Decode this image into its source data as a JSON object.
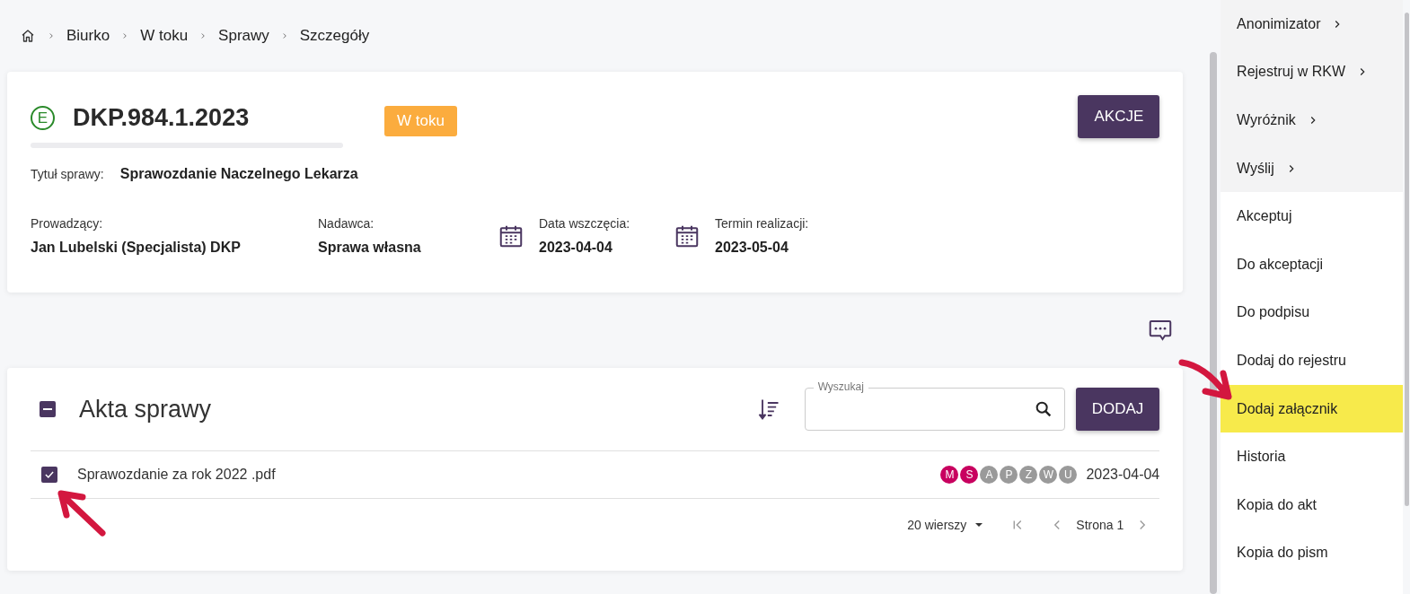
{
  "breadcrumb": [
    "Biurko",
    "W toku",
    "Sprawy",
    "Szczegóły"
  ],
  "case": {
    "badge": "E",
    "number": "DKP.984.1.2023",
    "status": "W toku",
    "actions_button": "AKCJE",
    "title_label": "Tytuł sprawy:",
    "title": "Sprawozdanie Naczelnego Lekarza",
    "fields": [
      {
        "kind": "text",
        "label": "Prowadzący:",
        "value": "Jan Lubelski (Specjalista) DKP"
      },
      {
        "kind": "text",
        "label": "Nadawca:",
        "value": "Sprawa własna"
      },
      {
        "kind": "date",
        "label": "Data wszczęcia:",
        "value": "2023-04-04"
      },
      {
        "kind": "date",
        "label": "Termin realizacji:",
        "value": "2023-05-04"
      }
    ]
  },
  "files": {
    "title": "Akta sprawy",
    "select_all_partial": true,
    "search": {
      "label": "Wyszukaj"
    },
    "add_button": "DODAJ",
    "rows": [
      {
        "name": "Sprawozdanie za rok 2022 .pdf",
        "checked": true,
        "date": "2023-04-04",
        "flags": [
          {
            "letter": "M",
            "on": true
          },
          {
            "letter": "S",
            "on": true
          },
          {
            "letter": "A",
            "on": false
          },
          {
            "letter": "P",
            "on": false
          },
          {
            "letter": "Z",
            "on": false
          },
          {
            "letter": "W",
            "on": false
          },
          {
            "letter": "U",
            "on": false
          }
        ]
      }
    ],
    "rows_per_page": "20 wierszy",
    "page": "Strona 1"
  },
  "menu": [
    {
      "label": "Anonimizator",
      "kind": "submenu",
      "highlighted": false
    },
    {
      "label": "Rejestruj w RKW",
      "kind": "submenu",
      "highlighted": false
    },
    {
      "label": "Wyróżnik",
      "kind": "submenu",
      "highlighted": false
    },
    {
      "label": "Wyślij",
      "kind": "submenu",
      "highlighted": false
    },
    {
      "label": "Akceptuj",
      "kind": "action",
      "highlighted": false
    },
    {
      "label": "Do akceptacji",
      "kind": "action",
      "highlighted": false
    },
    {
      "label": "Do podpisu",
      "kind": "action",
      "highlighted": false
    },
    {
      "label": "Dodaj do rejestru",
      "kind": "action",
      "highlighted": false
    },
    {
      "label": "Dodaj załącznik",
      "kind": "action",
      "highlighted": true
    },
    {
      "label": "Historia",
      "kind": "action",
      "highlighted": false
    },
    {
      "label": "Kopia do akt",
      "kind": "action",
      "highlighted": false
    },
    {
      "label": "Kopia do pism",
      "kind": "action",
      "highlighted": false
    }
  ]
}
